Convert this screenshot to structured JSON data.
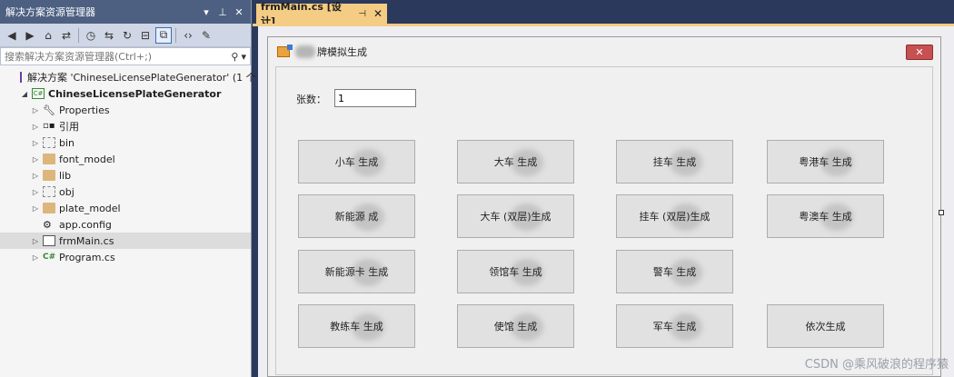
{
  "solution_explorer": {
    "title": "解决方案资源管理器",
    "title_icons": [
      "▾",
      "⊥",
      "✕"
    ],
    "search_placeholder": "搜索解决方案资源管理器(Ctrl+;)",
    "tree": [
      {
        "label": "解决方案 'ChineseLicensePlateGenerator' (1 个",
        "kind": "solution"
      },
      {
        "label": "ChineseLicensePlateGenerator",
        "kind": "project"
      },
      {
        "label": "Properties",
        "kind": "wrench"
      },
      {
        "label": "引用",
        "kind": "refs"
      },
      {
        "label": "bin",
        "kind": "folder-hidden"
      },
      {
        "label": "font_model",
        "kind": "folder"
      },
      {
        "label": "lib",
        "kind": "folder"
      },
      {
        "label": "obj",
        "kind": "folder-hidden"
      },
      {
        "label": "plate_model",
        "kind": "folder"
      },
      {
        "label": "app.config",
        "kind": "config"
      },
      {
        "label": "frmMain.cs",
        "kind": "form"
      },
      {
        "label": "Program.cs",
        "kind": "cs"
      }
    ]
  },
  "tab": {
    "label": "frmMain.cs [设计]",
    "pin": "⊣",
    "close": "✕"
  },
  "form": {
    "title": "牌模拟生成",
    "close_label": "✕",
    "count_label": "张数：",
    "count_value": "1",
    "buttons": [
      {
        "label": "小车    生成"
      },
      {
        "label": "大车    生成"
      },
      {
        "label": "挂车    生成"
      },
      {
        "label": "粤港车    生成"
      },
      {
        "label": "新能源        成"
      },
      {
        "label": "大车    (双层)生成"
      },
      {
        "label": "挂车    (双层)生成"
      },
      {
        "label": "粤澳车    生成"
      },
      {
        "label": "新能源卡    生成"
      },
      {
        "label": "领馆车    生成"
      },
      {
        "label": "警车    生成"
      },
      {
        "label": "教练车    生成"
      },
      {
        "label": "使馆    生成"
      },
      {
        "label": "军车    生成"
      },
      {
        "label": "依次生成"
      }
    ]
  },
  "watermark": "CSDN @乘风破浪的程序猿"
}
